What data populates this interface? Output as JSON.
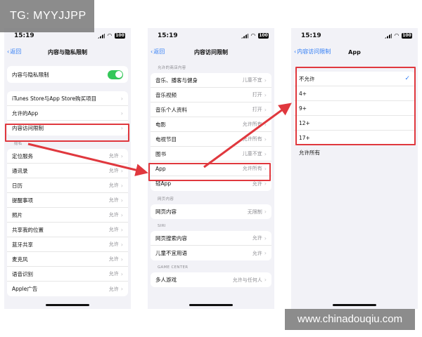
{
  "watermark": {
    "top": "TG: MYYJJPP",
    "bottom": "www.chinadouqiu.com"
  },
  "status": {
    "time": "15:19",
    "battery": "100"
  },
  "colors": {
    "accent": "#2f7cf6",
    "highlight": "#e0383e",
    "toggle_on": "#34c759"
  },
  "screen1": {
    "back": "返回",
    "title": "内容与隐私限制",
    "toggle_row": "内容与隐私限制",
    "toggle_on": true,
    "group2": [
      "iTunes Store与App Store购买项目",
      "允许的App",
      "内容访问限制"
    ],
    "privacy_header": "隐私",
    "privacy": [
      {
        "label": "定位服务",
        "value": "允许"
      },
      {
        "label": "通讯录",
        "value": "允许"
      },
      {
        "label": "日历",
        "value": "允许"
      },
      {
        "label": "提醒事项",
        "value": "允许"
      },
      {
        "label": "照片",
        "value": "允许"
      },
      {
        "label": "共享我的位置",
        "value": "允许"
      },
      {
        "label": "蓝牙共享",
        "value": "允许"
      },
      {
        "label": "麦克风",
        "value": "允许"
      },
      {
        "label": "语音识别",
        "value": "允许"
      },
      {
        "label": "Apple广告",
        "value": "允许"
      }
    ]
  },
  "screen2": {
    "back": "返回",
    "title": "内容访问限制",
    "store_header": "允许的商店内容",
    "store": [
      {
        "label": "音乐、播客与健身",
        "value": "儿童不宜"
      },
      {
        "label": "音乐视频",
        "value": "打开"
      },
      {
        "label": "音乐个人资料",
        "value": "打开"
      },
      {
        "label": "电影",
        "value": "允许所有"
      },
      {
        "label": "电视节目",
        "value": "允许所有"
      },
      {
        "label": "图书",
        "value": "儿童不宜"
      },
      {
        "label": "App",
        "value": "允许所有"
      },
      {
        "label": "轻App",
        "value": "允许"
      }
    ],
    "web_header": "网页内容",
    "web": [
      {
        "label": "网页内容",
        "value": "无限制"
      }
    ],
    "siri_header": "SIRI",
    "siri": [
      {
        "label": "网页搜索内容",
        "value": "允许"
      },
      {
        "label": "儿童不宜用语",
        "value": "允许"
      }
    ],
    "gc_header": "GAME CENTER",
    "gc": [
      {
        "label": "多人游戏",
        "value": "允许与任何人"
      }
    ]
  },
  "screen3": {
    "back": "内容访问限制",
    "title": "App",
    "options": [
      "不允许",
      "4+",
      "9+",
      "12+",
      "17+",
      "允许所有"
    ],
    "checked": "不允许"
  },
  "icons": {
    "back": "chevron-left-icon",
    "disclosure": "chevron-right-icon",
    "check": "checkmark-icon",
    "signal": "cellular-signal-icon",
    "wifi": "wifi-icon",
    "battery": "battery-icon"
  }
}
